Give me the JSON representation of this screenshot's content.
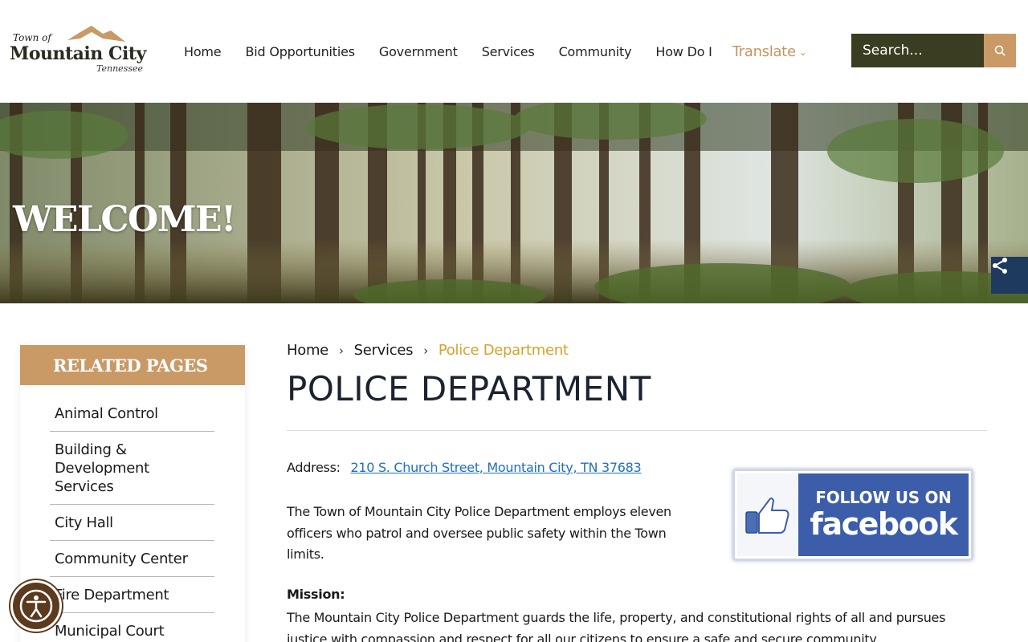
{
  "logo": {
    "town_of": "Town of",
    "name": "Mountain City",
    "state": "Tennessee",
    "colors": {
      "mountain": "#c99a66",
      "text": "#2b2b20"
    }
  },
  "nav": {
    "items": [
      "Home",
      "Bid Opportunities",
      "Government",
      "Services",
      "Community",
      "How Do I"
    ],
    "translate": "Translate",
    "translate_icon": "chevron-down-icon"
  },
  "search": {
    "placeholder": "Search...",
    "icon": "search-icon"
  },
  "banner": {
    "title": "WELCOME!",
    "share_icon": "share-icon"
  },
  "sidebar": {
    "heading": "RELATED PAGES",
    "items": [
      "Animal Control",
      "Building & Development Services",
      "City Hall",
      "Community Center",
      "Fire Department",
      "Municipal Court"
    ]
  },
  "breadcrumb": {
    "items": [
      "Home",
      "Services"
    ],
    "current": "Police Department",
    "separator": "›"
  },
  "page": {
    "title": "POLICE DEPARTMENT",
    "address_label": "Address:",
    "address_link": "210 S. Church Street, Mountain City, TN 37683",
    "intro": "The Town of Mountain City Police Department employs eleven officers who patrol and oversee public safety within the Town limits.",
    "mission_label": "Mission:",
    "mission_text": "The Mountain City Police Department guards the life, property, and constitutional rights of all and pursues justice with compassion and respect for all our citizens to ensure a safe and secure community."
  },
  "facebook_banner": {
    "line1": "FOLLOW US ON",
    "line2": "facebook",
    "icon": "thumbs-up-icon"
  },
  "accessibility": {
    "icon": "accessibility-icon"
  },
  "colors": {
    "accent": "#c99a66",
    "dark_olive": "#3a3d21",
    "link": "#1f6fc2",
    "crumb_current": "#d4a22e",
    "share_bg": "#1e3a5f"
  }
}
